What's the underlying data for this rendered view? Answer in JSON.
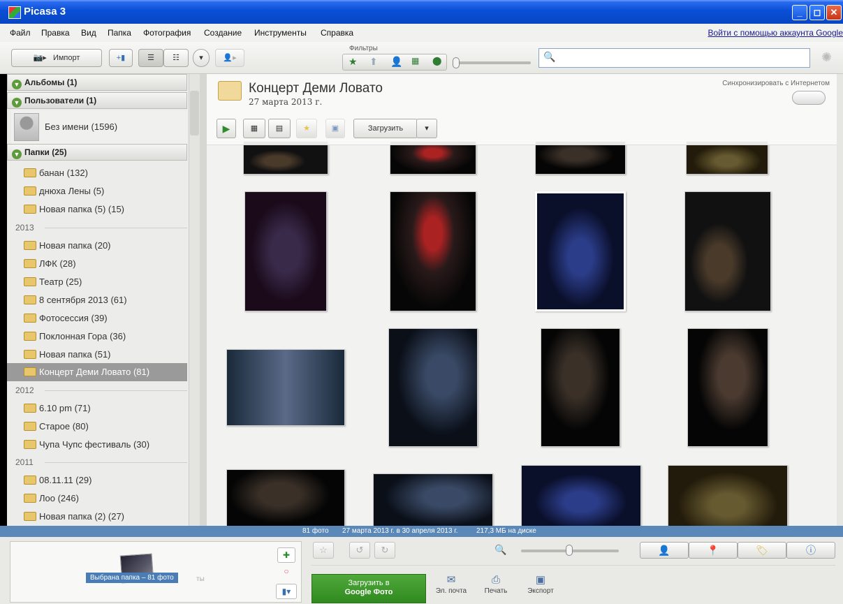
{
  "window": {
    "title": "Picasa 3",
    "minimize": "_",
    "maximize": "◻",
    "close": "✕"
  },
  "menu": {
    "items": [
      "Файл",
      "Правка",
      "Вид",
      "Папка",
      "Фотография",
      "Создание",
      "Инструменты",
      "Справка"
    ],
    "signin": "Войти с помощью аккаунта Google"
  },
  "toolbar": {
    "import_label": "Импорт",
    "filters_label": "Фильтры",
    "search_placeholder": ""
  },
  "sidebar": {
    "albums": "Альбомы (1)",
    "users": "Пользователи (1)",
    "user_name": "Без имени (1596)",
    "folders_head": "Папки (25)",
    "groups": [
      {
        "year": "",
        "folders": [
          "банан (132)",
          "днюха Лены (5)",
          "Новая папка (5) (15)"
        ]
      },
      {
        "year": "2013",
        "folders": [
          "Новая папка (20)",
          "ЛФК (28)",
          "Театр (25)",
          "8 сентября 2013 (61)",
          "Фотосессия (39)",
          "Поклонная Гора (36)",
          "Новая папка (51)",
          "Концерт Деми Ловато (81)"
        ]
      },
      {
        "year": "2012",
        "folders": [
          "6.10 pm (71)",
          "Старое (80)",
          "Чупа Чупс фестиваль (30)"
        ]
      },
      {
        "year": "2011",
        "folders": [
          "08.11.11 (29)",
          "Лоо (246)",
          "Новая папка (2) (27)"
        ]
      }
    ],
    "selected_folder": "Концерт Деми Ловато (81)"
  },
  "album": {
    "title": "Концерт Деми Ловато",
    "date": "27 марта 2013 г.",
    "sync_label": "Синхронизировать с Интернетом",
    "upload_label": "Загрузить"
  },
  "status": {
    "count": "81 фото",
    "range": "27 марта 2013 г. в 30 апреля 2013 г.",
    "size": "217,3 МБ на диске"
  },
  "tray": {
    "selected_label": "Выбрана папка – 81 фото",
    "ghost_text": "ты"
  },
  "actions": {
    "upload_line1": "Загрузить в",
    "upload_line2": "Google Фото",
    "email": "Эл. почта",
    "print": "Печать",
    "export": "Экспорт"
  },
  "colors": {
    "title_bar": "#0a4fd6",
    "status_bar": "#5a88b8",
    "selection": "#9a9a9a",
    "upload_button": "#3a9a2a"
  }
}
